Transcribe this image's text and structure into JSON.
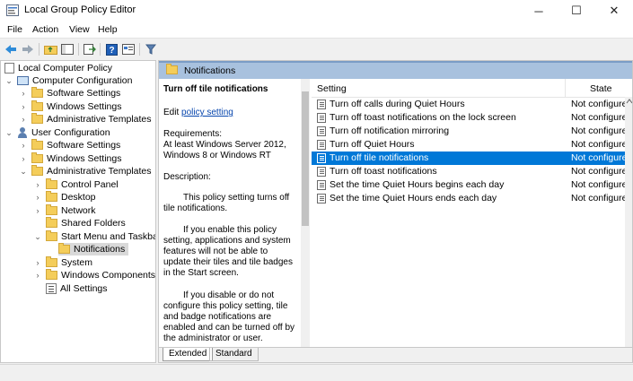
{
  "window": {
    "title": "Local Group Policy Editor",
    "minimize": "─",
    "maximize": "☐",
    "close": "✕"
  },
  "menu": [
    "File",
    "Action",
    "View",
    "Help"
  ],
  "tree": {
    "root": "Local Computer Policy",
    "computer_config": "Computer Configuration",
    "cc_software": "Software Settings",
    "cc_windows": "Windows Settings",
    "cc_admin": "Administrative Templates",
    "user_config": "User Configuration",
    "uc_software": "Software Settings",
    "uc_windows": "Windows Settings",
    "uc_admin": "Administrative Templates",
    "control_panel": "Control Panel",
    "desktop": "Desktop",
    "network": "Network",
    "shared_folders": "Shared Folders",
    "start_menu": "Start Menu and Taskbar",
    "notifications": "Notifications",
    "system": "System",
    "windows_components": "Windows Components",
    "all_settings": "All Settings"
  },
  "header": {
    "title": "Notifications"
  },
  "description": {
    "title": "Turn off tile notifications",
    "edit_prefix": "Edit",
    "edit_link": "policy setting",
    "requirements_label": "Requirements:",
    "requirements": "At least Windows Server 2012, Windows 8 or Windows RT",
    "description_label": "Description:",
    "para1": "This policy setting turns off tile notifications.",
    "para2": "If you enable this policy setting, applications and system features will not be able to update their tiles and tile badges in the Start screen.",
    "para3": "If you disable or do not configure this policy setting, tile and badge notifications are enabled and can be turned off by the administrator or user."
  },
  "list": {
    "col_setting": "Setting",
    "col_state": "State",
    "rows": [
      {
        "name": "Turn off calls during Quiet Hours",
        "state": "Not configured"
      },
      {
        "name": "Turn off toast notifications on the lock screen",
        "state": "Not configured"
      },
      {
        "name": "Turn off notification mirroring",
        "state": "Not configured"
      },
      {
        "name": "Turn off Quiet Hours",
        "state": "Not configured"
      },
      {
        "name": "Turn off tile notifications",
        "state": "Not configured"
      },
      {
        "name": "Turn off toast notifications",
        "state": "Not configured"
      },
      {
        "name": "Set the time Quiet Hours begins each day",
        "state": "Not configured"
      },
      {
        "name": "Set the time Quiet Hours ends each day",
        "state": "Not configured"
      }
    ]
  },
  "tabs": {
    "extended": "Extended",
    "standard": "Standard"
  },
  "colors": {
    "selection": "#0078d7",
    "header_band": "#a8c1de",
    "folder": "#f4cd5a"
  }
}
